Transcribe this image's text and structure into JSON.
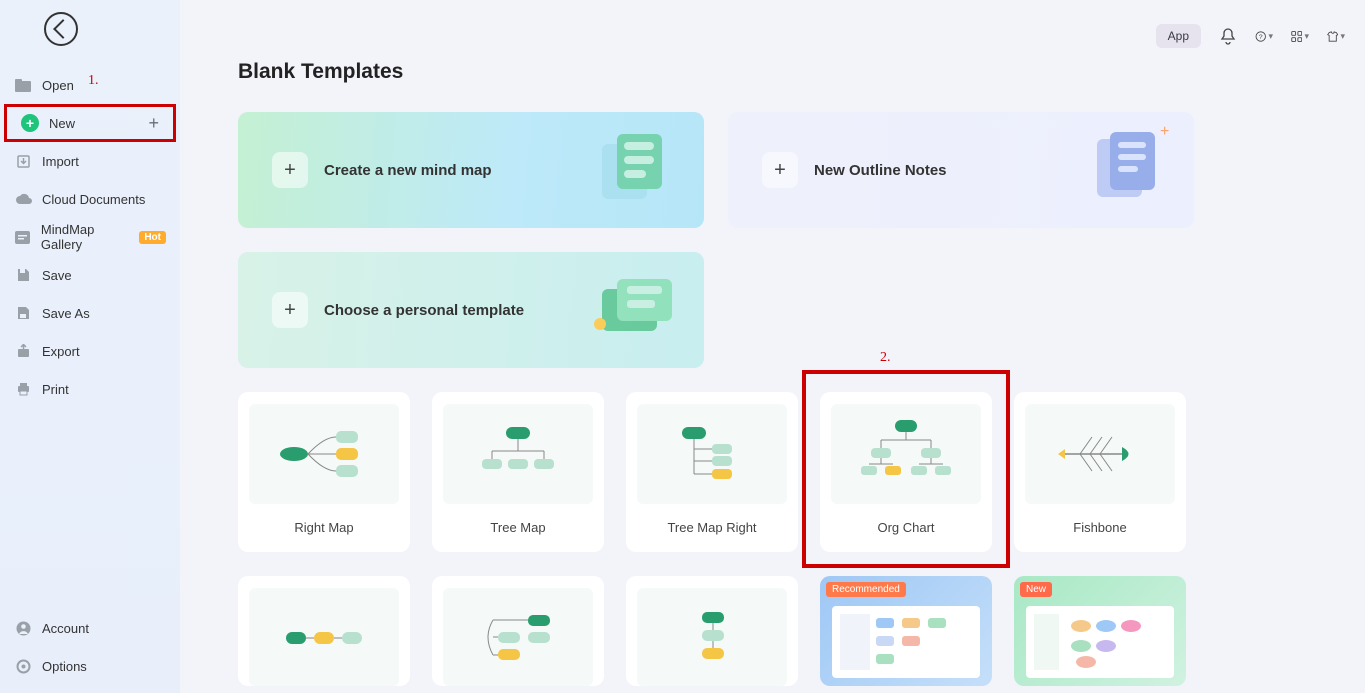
{
  "topbar": {
    "app_button": "App"
  },
  "sidebar": {
    "open": "Open",
    "new": "New",
    "import": "Import",
    "cloud": "Cloud Documents",
    "gallery": "MindMap Gallery",
    "hot": "Hot",
    "save": "Save",
    "save_as": "Save As",
    "export": "Export",
    "print": "Print",
    "account": "Account",
    "options": "Options"
  },
  "main": {
    "title": "Blank Templates",
    "hero": {
      "mind": "Create a new mind map",
      "outline": "New Outline Notes",
      "personal": "Choose a personal template"
    },
    "templates": [
      {
        "name": "Right Map"
      },
      {
        "name": "Tree Map"
      },
      {
        "name": "Tree Map Right"
      },
      {
        "name": "Org Chart"
      },
      {
        "name": "Fishbone"
      }
    ],
    "row2": {
      "recommended": "Recommended",
      "new": "New"
    }
  },
  "annotations": {
    "a1": "1.",
    "a2": "2."
  }
}
